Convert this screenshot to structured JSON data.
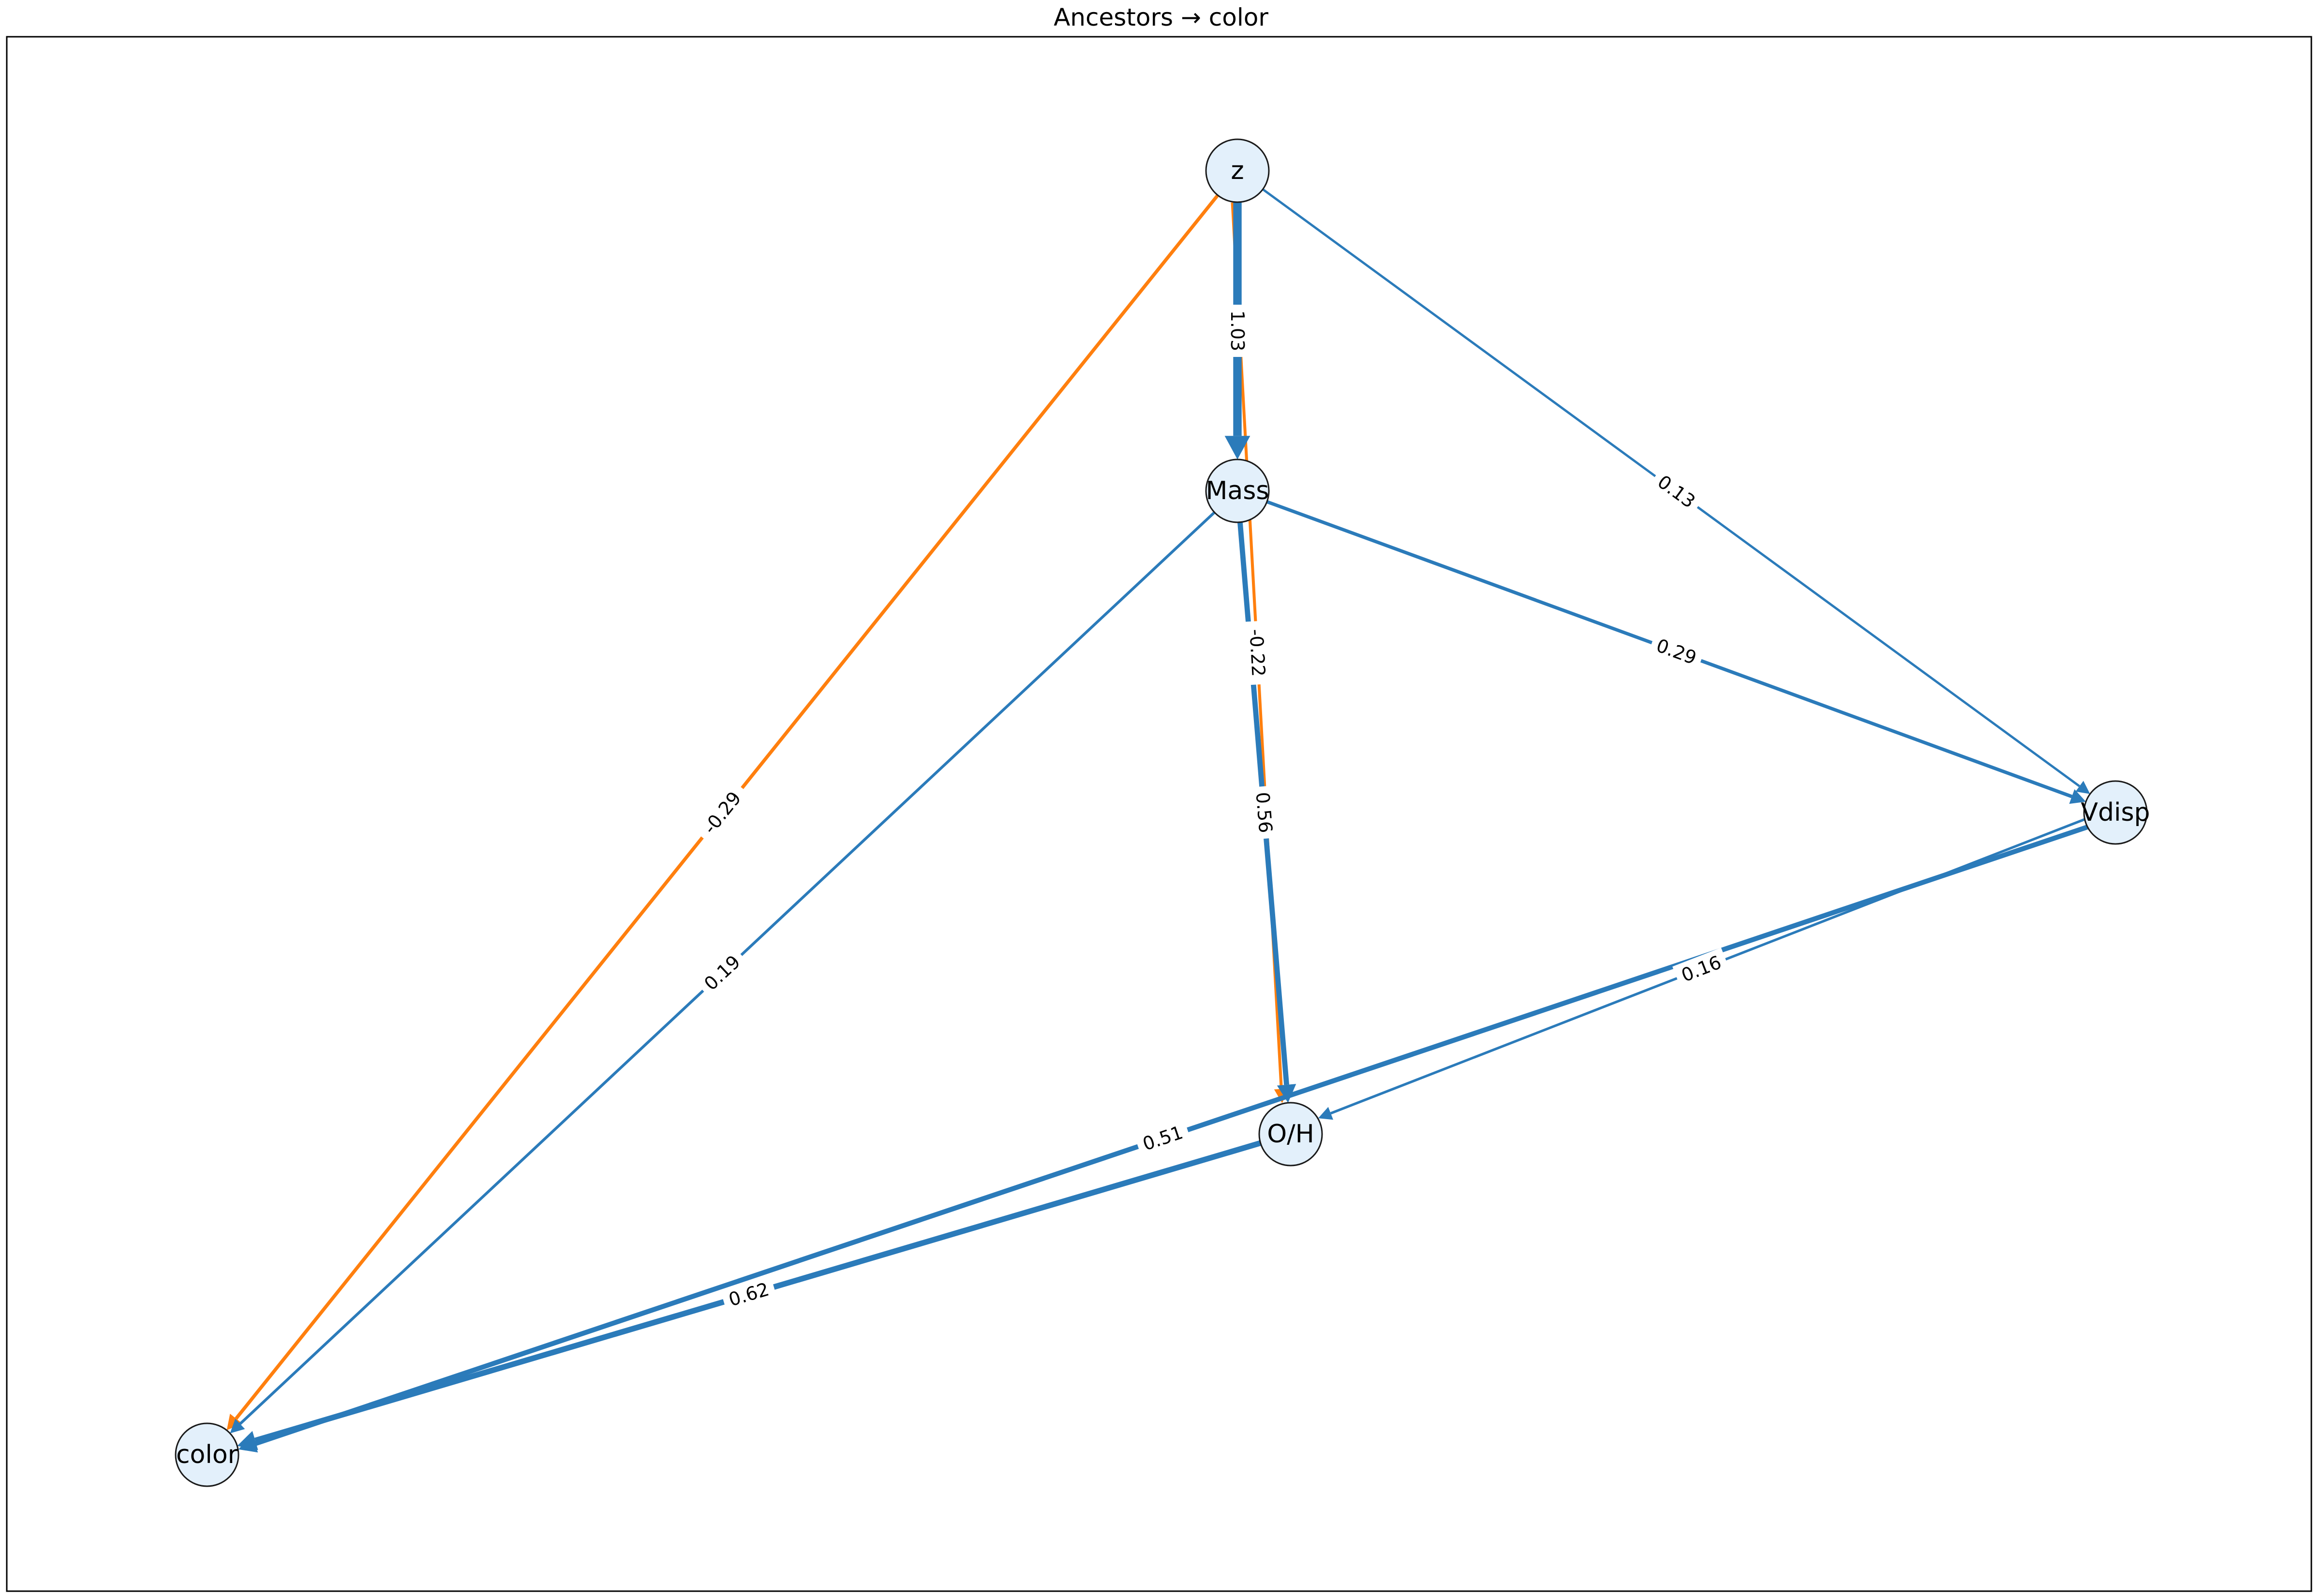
{
  "title": "Ancestors → color",
  "colors": {
    "positive_edge": "#2b7bba",
    "negative_edge": "#ff7f0e",
    "node_fill": "#e3f0fb",
    "node_stroke": "#1a1a1a",
    "frame": "#000000"
  },
  "graph": {
    "nodes": [
      {
        "id": "z",
        "label": "z"
      },
      {
        "id": "mass",
        "label": "Mass"
      },
      {
        "id": "vdisp",
        "label": "Vdisp"
      },
      {
        "id": "oh",
        "label": "O/H"
      },
      {
        "id": "color",
        "label": "color"
      }
    ],
    "edges": [
      {
        "id": "z-color",
        "source": "z",
        "target": "color",
        "weight": -0.29,
        "label": "-0.29"
      },
      {
        "id": "z-oh",
        "source": "z",
        "target": "oh",
        "weight": -0.22,
        "label": "-0.22"
      },
      {
        "id": "z-vdisp",
        "source": "z",
        "target": "vdisp",
        "weight": 0.13,
        "label": "0.13"
      },
      {
        "id": "mass-color",
        "source": "mass",
        "target": "color",
        "weight": 0.19,
        "label": "0.19"
      },
      {
        "id": "vdisp-oh",
        "source": "vdisp",
        "target": "oh",
        "weight": 0.16,
        "label": "0.16"
      },
      {
        "id": "mass-vdisp",
        "source": "mass",
        "target": "vdisp",
        "weight": 0.29,
        "label": "0.29"
      },
      {
        "id": "vdisp-color",
        "source": "vdisp",
        "target": "color",
        "weight": 0.51,
        "label": "0.51"
      },
      {
        "id": "mass-oh",
        "source": "mass",
        "target": "oh",
        "weight": 0.56,
        "label": "0.56"
      },
      {
        "id": "oh-color",
        "source": "oh",
        "target": "color",
        "weight": 0.62,
        "label": "0.62"
      },
      {
        "id": "z-mass",
        "source": "z",
        "target": "mass",
        "weight": 1.03,
        "label": "1.03"
      }
    ]
  }
}
